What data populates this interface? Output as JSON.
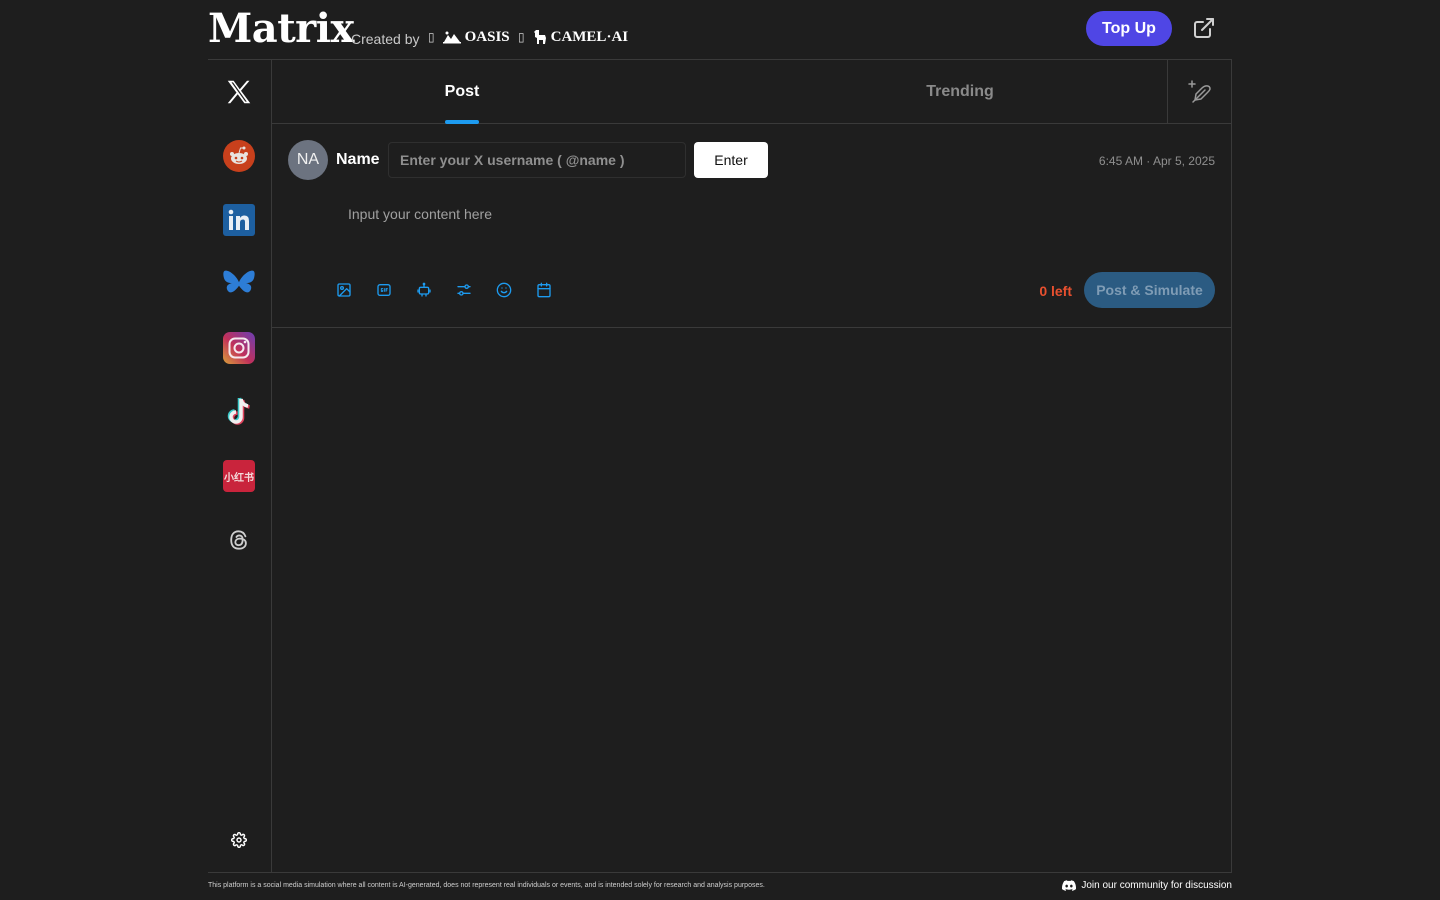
{
  "header": {
    "brand": "Matrix",
    "created_by": "Created by",
    "partners": [
      {
        "name": "OASIS",
        "icon": "oasis-logo-icon"
      },
      {
        "name": "CAMEL·AI",
        "icon": "camel-logo-icon"
      }
    ],
    "topup_label": "Top Up",
    "external_icon": "external-link-icon"
  },
  "sidebar": {
    "platforms": [
      {
        "name": "X",
        "icon": "x-logo-icon"
      },
      {
        "name": "Reddit",
        "icon": "reddit-icon"
      },
      {
        "name": "LinkedIn",
        "icon": "linkedin-icon"
      },
      {
        "name": "Bluesky",
        "icon": "bluesky-icon"
      },
      {
        "name": "Instagram",
        "icon": "instagram-icon"
      },
      {
        "name": "TikTok",
        "icon": "tiktok-icon"
      },
      {
        "name": "Xiaohongshu",
        "icon": "xiaohongshu-icon",
        "text": "小红书"
      },
      {
        "name": "Threads",
        "icon": "threads-icon"
      }
    ],
    "settings_icon": "gear-icon"
  },
  "tabs": [
    {
      "label": "Post",
      "active": true
    },
    {
      "label": "Trending",
      "active": false
    }
  ],
  "composer": {
    "avatar_initials": "NA",
    "name_label": "Name",
    "username_placeholder": "Enter your X username ( @name )",
    "username_value": "",
    "enter_label": "Enter",
    "timestamp": "6:45 AM · Apr 5, 2025",
    "content_placeholder": "Input your content here",
    "content_value": "",
    "tools": [
      "image-icon",
      "gif-icon",
      "robot-icon",
      "sliders-icon",
      "emoji-icon",
      "calendar-icon"
    ],
    "chars_left": "0 left",
    "post_label": "Post & Simulate"
  },
  "footer": {
    "disclaimer": "This platform is a social media simulation where all content is AI-generated, does not represent real individuals or events, and is intended solely for research and analysis purposes.",
    "community": "Join our community for discussion",
    "community_icon": "discord-icon"
  },
  "colors": {
    "background": "#1e1e1e",
    "accent": "#1d9bf0",
    "topup": "#4f46e5",
    "warning": "#e8502f",
    "post_button": "#2b5b82"
  }
}
